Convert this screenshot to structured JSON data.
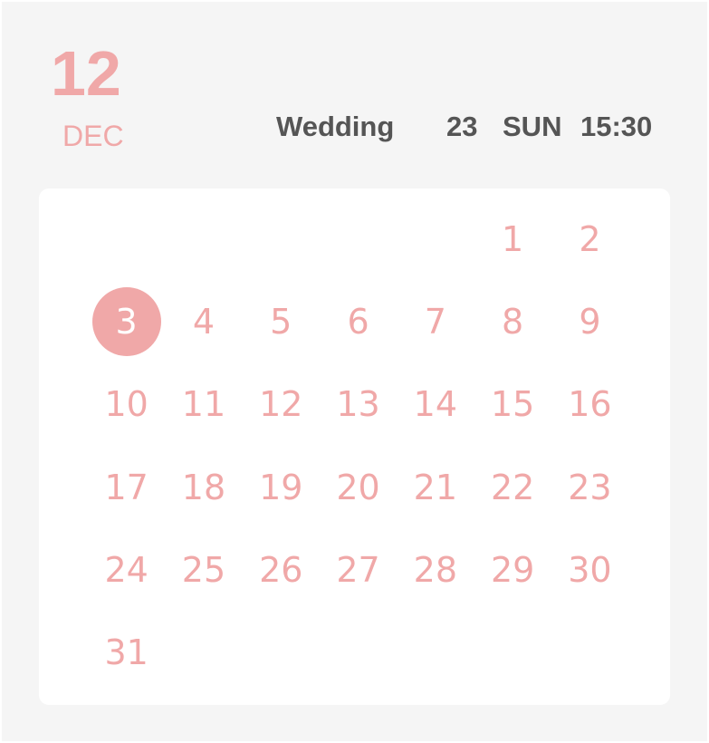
{
  "header": {
    "month_number": "12",
    "month_name": "DEC"
  },
  "event": {
    "title": "Wedding",
    "day": "23",
    "weekday": "SUN",
    "time": "15:30"
  },
  "calendar": {
    "leading_blanks": 5,
    "selected_day": "3",
    "days": [
      "1",
      "2",
      "3",
      "4",
      "5",
      "6",
      "7",
      "8",
      "9",
      "10",
      "11",
      "12",
      "13",
      "14",
      "15",
      "16",
      "17",
      "18",
      "19",
      "20",
      "21",
      "22",
      "23",
      "24",
      "25",
      "26",
      "27",
      "28",
      "29",
      "30",
      "31"
    ]
  },
  "colors": {
    "accent": "#f0a8a8",
    "text_dark": "#555555",
    "background": "#f5f5f5",
    "card": "#ffffff"
  }
}
